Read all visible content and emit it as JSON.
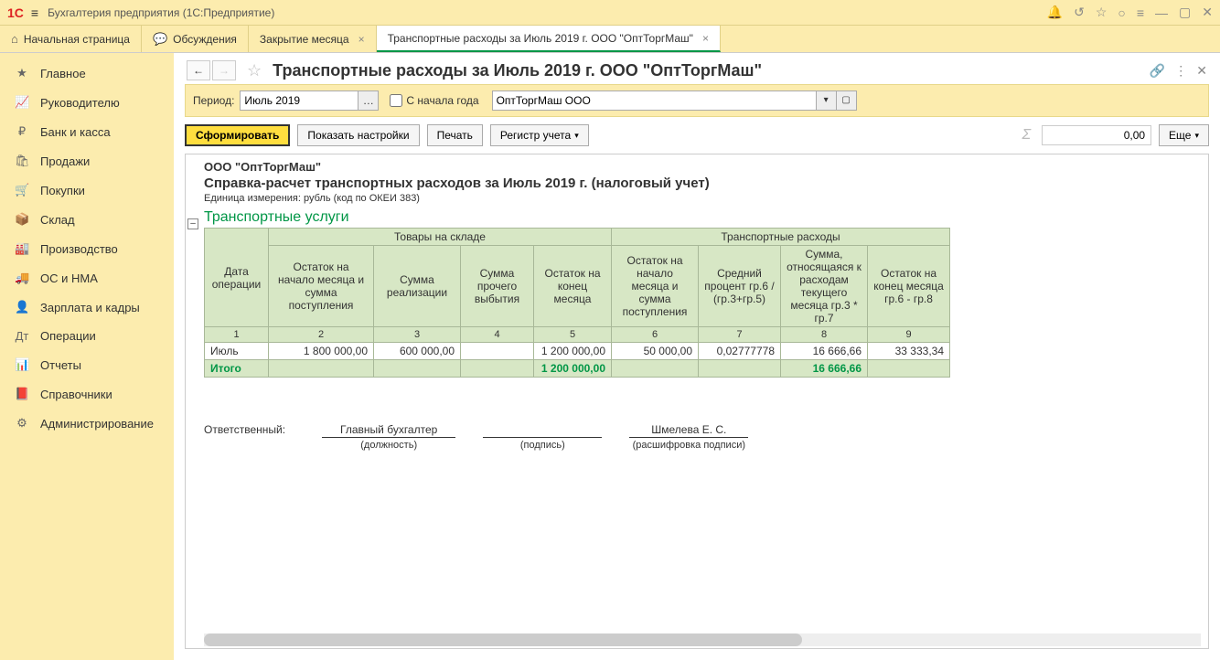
{
  "titlebar": {
    "title": "Бухгалтерия предприятия  (1С:Предприятие)",
    "logo": "1С"
  },
  "tabs": {
    "home": "Начальная страница",
    "discuss": "Обсуждения",
    "close_month": "Закрытие месяца",
    "active": "Транспортные расходы за Июль 2019 г. ООО \"ОптТоргМаш\""
  },
  "sidebar": [
    {
      "icon": "★",
      "label": "Главное"
    },
    {
      "icon": "📈",
      "label": "Руководителю"
    },
    {
      "icon": "₽",
      "label": "Банк и касса"
    },
    {
      "icon": "🛍",
      "label": "Продажи"
    },
    {
      "icon": "🛒",
      "label": "Покупки"
    },
    {
      "icon": "📦",
      "label": "Склад"
    },
    {
      "icon": "🏭",
      "label": "Производство"
    },
    {
      "icon": "🚚",
      "label": "ОС и НМА"
    },
    {
      "icon": "👤",
      "label": "Зарплата и кадры"
    },
    {
      "icon": "Дт",
      "label": "Операции"
    },
    {
      "icon": "📊",
      "label": "Отчеты"
    },
    {
      "icon": "📕",
      "label": "Справочники"
    },
    {
      "icon": "⚙",
      "label": "Администрирование"
    }
  ],
  "page": {
    "title": "Транспортные расходы за Июль 2019 г. ООО \"ОптТоргМаш\"",
    "period_label": "Период:",
    "period_value": "Июль 2019",
    "from_start_label": "С начала года",
    "org_value": "ОптТоргМаш ООО",
    "btn_form": "Сформировать",
    "btn_settings": "Показать настройки",
    "btn_print": "Печать",
    "btn_register": "Регистр учета",
    "sum_value": "0,00",
    "btn_more": "Еще"
  },
  "report": {
    "org": "ООО \"ОптТоргМаш\"",
    "title": "Справка-расчет транспортных расходов за Июль 2019 г. (налоговый учет)",
    "unit": "Единица измерения:  рубль (код по ОКЕИ 383)",
    "section": "Транспортные услуги",
    "headers": {
      "goods": "Товары на складе",
      "trans": "Транспортные расходы",
      "date": "Дата операции",
      "h2": "Остаток на начало месяца и сумма поступления",
      "h3": "Сумма реализации",
      "h4": "Сумма прочего выбытия",
      "h5": "Остаток на конец месяца",
      "h6": "Остаток на начало месяца и сумма поступления",
      "h7": "Средний процент гр.6 / (гр.3+гр.5)",
      "h8": "Сумма, относящаяся к расходам текущего месяца гр.3 * гр.7",
      "h9": "Остаток на конец месяца гр.6 - гр.8"
    },
    "nums": [
      "1",
      "2",
      "3",
      "4",
      "5",
      "6",
      "7",
      "8",
      "9"
    ],
    "row": {
      "c1": "Июль",
      "c2": "1 800 000,00",
      "c3": "600 000,00",
      "c4": "",
      "c5": "1 200 000,00",
      "c6": "50 000,00",
      "c7": "0,02777778",
      "c8": "16 666,66",
      "c9": "33 333,34"
    },
    "total": {
      "label": "Итого",
      "c5": "1 200 000,00",
      "c8": "16 666,66"
    },
    "sign": {
      "resp": "Ответственный:",
      "position": "Главный бухгалтер",
      "position_hint": "(должность)",
      "sign_hint": "(подпись)",
      "name": "Шмелева Е. С.",
      "name_hint": "(расшифровка подписи)"
    }
  },
  "chart_data": {
    "type": "table",
    "title": "Транспортные услуги",
    "columns": [
      "Дата операции",
      "Остаток на начало месяца и сумма поступления",
      "Сумма реализации",
      "Сумма прочего выбытия",
      "Остаток на конец месяца",
      "Остаток на начало месяца и сумма поступления",
      "Средний процент",
      "Сумма относящаяся к расходам текущего месяца",
      "Остаток на конец месяца"
    ],
    "rows": [
      [
        "Июль",
        1800000.0,
        600000.0,
        null,
        1200000.0,
        50000.0,
        0.02777778,
        16666.66,
        33333.34
      ]
    ],
    "totals": {
      "Остаток на конец месяца": 1200000.0,
      "Сумма относящаяся к расходам текущего месяца": 16666.66
    }
  }
}
